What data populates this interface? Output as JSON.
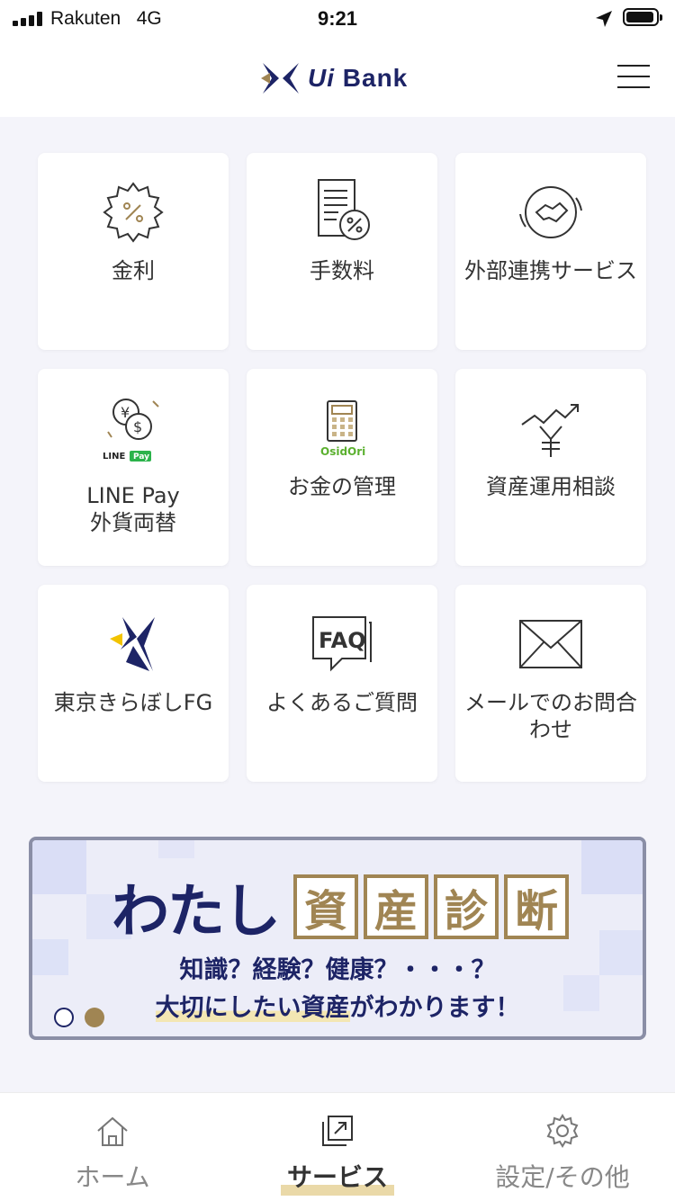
{
  "status_bar": {
    "carrier": "Rakuten",
    "network": "4G",
    "time": "9:21"
  },
  "header": {
    "logo_text": "Bank",
    "logo_wi": "Ui",
    "menu_icon": "hamburger-icon"
  },
  "tiles": [
    {
      "label": "金利",
      "icon": "percent-gear-icon"
    },
    {
      "label": "手数料",
      "icon": "document-percent-icon"
    },
    {
      "label": "外部連携サービス",
      "icon": "handshake-icon"
    },
    {
      "label": "LINE Pay\n外貨両替",
      "icon": "currency-exchange-icon",
      "badge": "LINE Pay"
    },
    {
      "label": "お金の管理",
      "icon": "calculator-icon",
      "badge": "OsidOri"
    },
    {
      "label": "資産運用相談",
      "icon": "yen-chart-icon"
    },
    {
      "label": "東京きらぼしFG",
      "icon": "kiraboshi-logo-icon"
    },
    {
      "label": "よくあるご質問",
      "icon": "faq-icon",
      "badge": "FAQ"
    },
    {
      "label": "メールでのお問合\nわせ",
      "icon": "envelope-icon"
    }
  ],
  "banner": {
    "title_prefix": "わたし",
    "title_boxes": [
      "資",
      "産",
      "診",
      "断"
    ],
    "line1": "知識？経験？健康？・・・？",
    "line2_highlight": "大切にしたい資産",
    "line2_rest": "がわかります！",
    "carousel": {
      "count": 2,
      "active": 2
    }
  },
  "tabbar": {
    "items": [
      {
        "label": "ホーム",
        "icon": "home-icon",
        "active": false
      },
      {
        "label": "サービス",
        "icon": "service-icon",
        "active": true
      },
      {
        "label": "設定/その他",
        "icon": "gear-icon",
        "active": false
      }
    ]
  },
  "colors": {
    "navy": "#1d2466",
    "gold": "#a08553",
    "highlight": "#ead9a8"
  }
}
